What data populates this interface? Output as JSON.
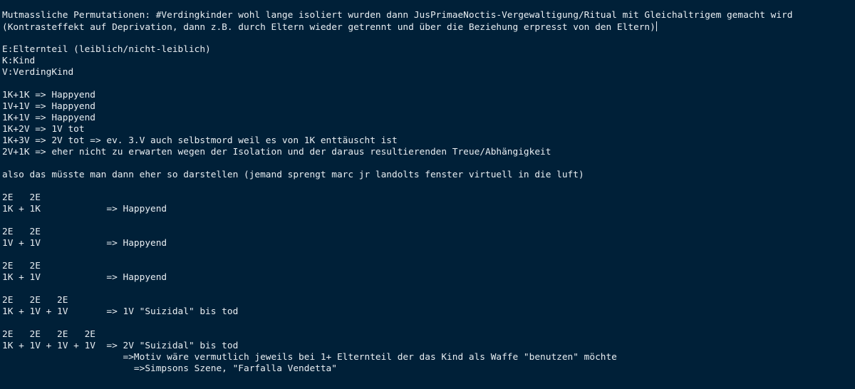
{
  "editor": {
    "lines": [
      "Mutmassliche Permutationen: #Verdingkinder wohl lange isoliert wurden dann JusPrimaeNoctis-Vergewaltigung/Ritual mit Gleichaltrigem gemacht wird",
      "(Kontrasteffekt auf Deprivation, dann z.B. durch Eltern wieder getrennt und über die Beziehung erpresst von den Eltern)",
      "",
      "E:Elternteil (leiblich/nicht-leiblich)",
      "K:Kind",
      "V:VerdingKind",
      "",
      "1K+1K => Happyend",
      "1V+1V => Happyend",
      "1K+1V => Happyend",
      "1K+2V => 1V tot",
      "1K+3V => 2V tot => ev. 3.V auch selbstmord weil es von 1K enttäuscht ist",
      "2V+1K => eher nicht zu erwarten wegen der Isolation und der daraus resultierenden Treue/Abhängigkeit",
      "",
      "also das müsste man dann eher so darstellen (jemand sprengt marc jr landolts fenster virtuell in die luft)",
      "",
      "2E   2E",
      "1K + 1K            => Happyend",
      "",
      "2E   2E",
      "1V + 1V            => Happyend",
      "",
      "2E   2E",
      "1K + 1V            => Happyend",
      "",
      "2E   2E   2E",
      "1K + 1V + 1V       => 1V \"Suizidal\" bis tod",
      "",
      "2E   2E   2E   2E",
      "1K + 1V + 1V + 1V  => 2V \"Suizidal\" bis tod",
      "                      =>Motiv wäre vermutlich jeweils bei 1+ Elternteil der das Kind als Waffe \"benutzen\" möchte",
      "                        =>Simpsons Szene, \"Farfalla Vendetta\""
    ]
  }
}
